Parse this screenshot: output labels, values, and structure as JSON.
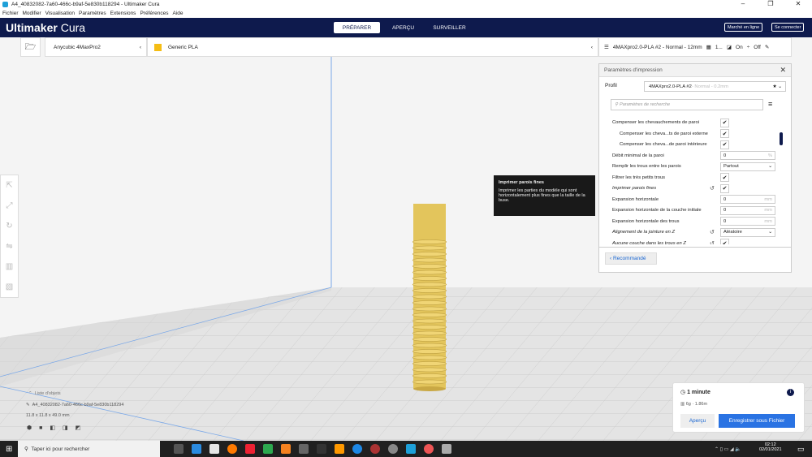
{
  "window": {
    "title": "A4_40832082-7a60-466c-b9af-5e830b118294 - Ultimaker Cura",
    "min": "–",
    "max": "❐",
    "close": "✕"
  },
  "menu": [
    "Fichier",
    "Modifier",
    "Visualisation",
    "Paramètres",
    "Extensions",
    "Préférences",
    "Aide"
  ],
  "header": {
    "brand_bold": "Ultimaker",
    "brand_light": "Cura",
    "stages": [
      "PRÉPARER",
      "APERÇU",
      "SURVEILLER"
    ],
    "marketplace": "Marché en ligne",
    "login": "Se connecter"
  },
  "toolbar": {
    "printer": "Anycubic 4MaxPro2",
    "material": "Generic PLA",
    "profile_summary": "4MAXpro2.0-PLA #2 - Normal - 12mm",
    "infill": "1...",
    "support": "On",
    "adhesion": "Off"
  },
  "settings": {
    "title": "Paramètres d'impression",
    "profile_label": "Profil",
    "profile_value": "4MAXpro2.0-PLA #2",
    "profile_suffix": " - Normal - 0.2mm",
    "search_placeholder": "Paramètres de recherche",
    "recommended": "Recommandé",
    "rows": [
      {
        "label": "Compenser les chevauchements de paroi",
        "type": "check",
        "value": "✔"
      },
      {
        "label": "Compenser les cheva...ts de paroi externe",
        "type": "check",
        "value": "✔",
        "indent": true
      },
      {
        "label": "Compenser les cheva...de paroi intérieure",
        "type": "check",
        "value": "✔",
        "indent": true
      },
      {
        "label": "Débit minimal de la paroi",
        "type": "field",
        "value": "0",
        "unit": "%"
      },
      {
        "label": "Remplir les trous entre les parois",
        "type": "select",
        "value": "Partout"
      },
      {
        "label": "Filtrer les très petits trous",
        "type": "check",
        "value": "✔"
      },
      {
        "label": "Imprimer parois fines",
        "type": "check",
        "value": "✔",
        "italic": true,
        "reset": true
      },
      {
        "label": "Expansion horizontale",
        "type": "field",
        "value": "0",
        "unit": "mm"
      },
      {
        "label": "Expansion horizontale de la couche initiale",
        "type": "field",
        "value": "0",
        "unit": "mm"
      },
      {
        "label": "Expansion horizontale des trous",
        "type": "field",
        "value": "0",
        "unit": "mm"
      },
      {
        "label": "Alignement de la jointure en Z",
        "type": "select",
        "value": "Aléatoire",
        "italic": true,
        "reset": true
      },
      {
        "label": "Aucune couche dans les trous en Z",
        "type": "check",
        "value": "✔",
        "italic": true,
        "reset": true
      }
    ]
  },
  "tooltip": {
    "title": "Imprimer parois fines",
    "body": "Imprimer les parties du modèle qui sont horizontalement plus fines que la taille de la buse."
  },
  "objects": {
    "header": "Liste d'objets",
    "name": "A4_40832082-7a60-466c-b9af-5e830b118294",
    "dims": "11.8 x 11.8 x 49.0 mm"
  },
  "print": {
    "time": "1 minute",
    "material": "6g · 1.86m",
    "preview": "Aperçu",
    "save": "Enregistrer sous Fichier"
  },
  "taskbar": {
    "search": "Taper ici pour rechercher",
    "time": "02:12",
    "date": "02/01/2021"
  }
}
